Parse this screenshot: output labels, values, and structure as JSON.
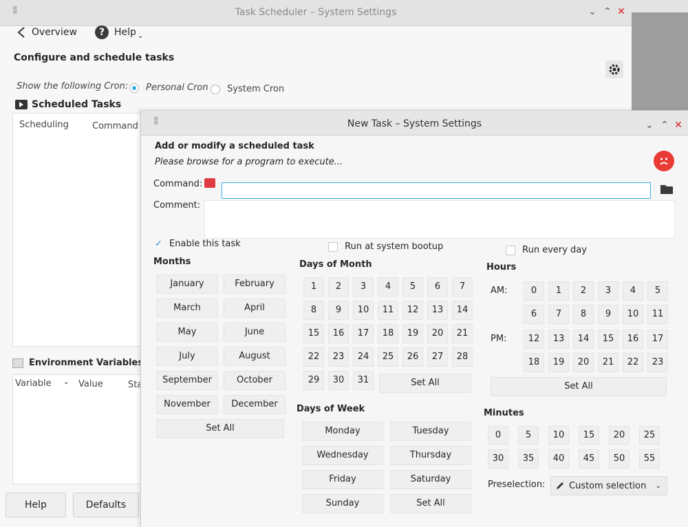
{
  "bg_window": {
    "title": "Task Scheduler – System Settings",
    "overview_label": "Overview",
    "help_label": "Help",
    "heading": "Configure and schedule tasks",
    "show_cron_label": "Show the following Cron:",
    "personal_cron": "Personal Cron",
    "system_cron": "System Cron",
    "scheduled_tasks": "Scheduled Tasks",
    "col_scheduling": "Scheduling",
    "col_command": "Command",
    "env_vars": "Environment Variables",
    "col_variable": "Variable",
    "col_value": "Value",
    "col_status": "Sta",
    "btn_help": "Help",
    "btn_defaults": "Defaults"
  },
  "dialog": {
    "title": "New Task – System Settings",
    "heading": "Add or modify a scheduled task",
    "subheading": "Please browse for a program to execute...",
    "command_label": "Command:",
    "command_value": "",
    "comment_label": "Comment:",
    "enable_task": "Enable this task",
    "run_bootup": "Run at system bootup",
    "run_every_day": "Run every day",
    "months_title": "Months",
    "months": [
      "January",
      "February",
      "March",
      "April",
      "May",
      "June",
      "July",
      "August",
      "September",
      "October",
      "November",
      "December"
    ],
    "months_set_all": "Set All",
    "dom_title": "Days of Month",
    "dom": [
      "1",
      "2",
      "3",
      "4",
      "5",
      "6",
      "7",
      "8",
      "9",
      "10",
      "11",
      "12",
      "13",
      "14",
      "15",
      "16",
      "17",
      "18",
      "19",
      "20",
      "21",
      "22",
      "23",
      "24",
      "25",
      "26",
      "27",
      "28",
      "29",
      "30",
      "31"
    ],
    "dom_set_all": "Set All",
    "dow_title": "Days of Week",
    "dow": [
      "Monday",
      "Tuesday",
      "Wednesday",
      "Thursday",
      "Friday",
      "Saturday",
      "Sunday"
    ],
    "dow_set_all": "Set All",
    "hours_title": "Hours",
    "am_label": "AM:",
    "pm_label": "PM:",
    "hours_am": [
      "0",
      "1",
      "2",
      "3",
      "4",
      "5",
      "6",
      "7",
      "8",
      "9",
      "10",
      "11"
    ],
    "hours_pm": [
      "12",
      "13",
      "14",
      "15",
      "16",
      "17",
      "18",
      "19",
      "20",
      "21",
      "22",
      "23"
    ],
    "hours_set_all": "Set All",
    "minutes_title": "Minutes",
    "minutes": [
      "0",
      "5",
      "10",
      "15",
      "20",
      "25",
      "30",
      "35",
      "40",
      "45",
      "50",
      "55"
    ],
    "preselection_label": "Preselection:",
    "preselection_value": "Custom selection"
  },
  "colors": {
    "accent": "#3daee9",
    "close": "#da1c23",
    "error": "#e93a35"
  },
  "icons": [
    "back-arrow-icon",
    "help-icon",
    "gear-icon",
    "video-icon",
    "environment-icon",
    "frown-icon",
    "command-icon",
    "folder-icon",
    "check-icon",
    "pencil-icon",
    "chevron-down-icon"
  ]
}
